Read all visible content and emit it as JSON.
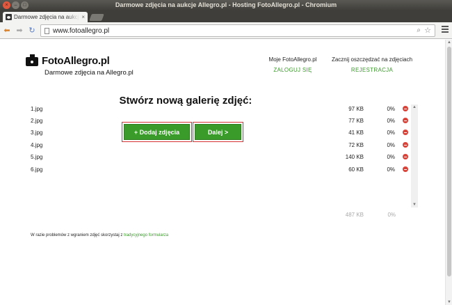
{
  "window": {
    "title": "Darmowe zdjęcia na aukcje Allegro.pl - Hosting FotoAllegro.pl - Chromium",
    "close_glyph": "×",
    "min_glyph": "–",
    "max_glyph": "□"
  },
  "tab": {
    "title": "Darmowe zdjęcia na aukcje Allegro.pl",
    "close_glyph": "×"
  },
  "address_bar": {
    "url": "www.fotoallegro.pl"
  },
  "site": {
    "logo_name": "FotoAllegro.pl",
    "tagline": "Darmowe zdjęcia na Allegro.pl",
    "account": {
      "heading": "Moje FotoAllegro.pl",
      "link": "ZALOGUJ SIĘ"
    },
    "register": {
      "heading": "Zacznij oszczędzać na zdjęciach",
      "link": "REJESTRACJA"
    }
  },
  "gallery": {
    "title": "Stwórz nową galerię zdjęć:",
    "add_button": "+ Dodaj zdjęcia",
    "next_button": "Dalej >",
    "files": [
      {
        "name": "1.jpg",
        "size": "97 KB",
        "progress": "0%"
      },
      {
        "name": "2.jpg",
        "size": "77 KB",
        "progress": "0%"
      },
      {
        "name": "3.jpg",
        "size": "41 KB",
        "progress": "0%"
      },
      {
        "name": "4.jpg",
        "size": "72 KB",
        "progress": "0%"
      },
      {
        "name": "5.jpg",
        "size": "140 KB",
        "progress": "0%"
      },
      {
        "name": "6.jpg",
        "size": "60 KB",
        "progress": "0%"
      }
    ],
    "total_size": "487 KB",
    "total_progress": "0%"
  },
  "footer": {
    "text": "W razie problemów z wgraniem zdjęć skorzystaj z",
    "link": "tradycyjnego formularza"
  },
  "colors": {
    "accent_green": "#3a9a2a",
    "highlight_red": "#d43232",
    "remove_red": "#d9443a"
  },
  "icons": [
    "back-arrow-icon",
    "forward-arrow-icon",
    "reload-icon",
    "page-icon",
    "zoom-icon",
    "star-icon",
    "menu-icon",
    "camera-logo-icon",
    "remove-file-icon"
  ]
}
